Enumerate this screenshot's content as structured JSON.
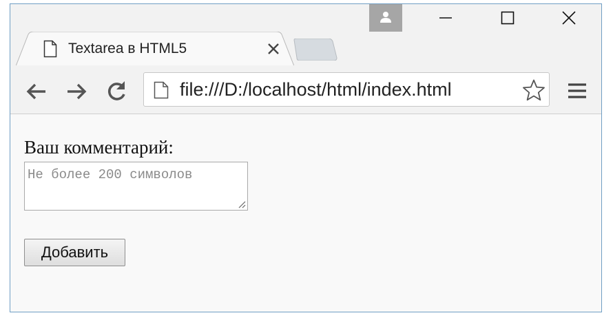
{
  "browser": {
    "tab": {
      "title": "Textarea в HTML5",
      "favicon": "page-icon"
    },
    "address_bar": {
      "url": "file:///D:/localhost/html/index.html"
    },
    "window_controls": [
      "minimize-icon",
      "maximize-icon",
      "close-icon"
    ],
    "toolbar_icons": [
      "back-arrow-icon",
      "forward-arrow-icon",
      "reload-icon",
      "star-icon",
      "menu-icon"
    ]
  },
  "page": {
    "comment_label": "Ваш комментарий:",
    "comment_placeholder": "Не более 200 символов",
    "comment_value": "",
    "submit_label": "Добавить"
  },
  "colors": {
    "window_border": "#6f9ec4",
    "chrome_background": "#f2f2f2",
    "page_background": "#f9f9f9",
    "profile_button": "#a6a6a6"
  }
}
